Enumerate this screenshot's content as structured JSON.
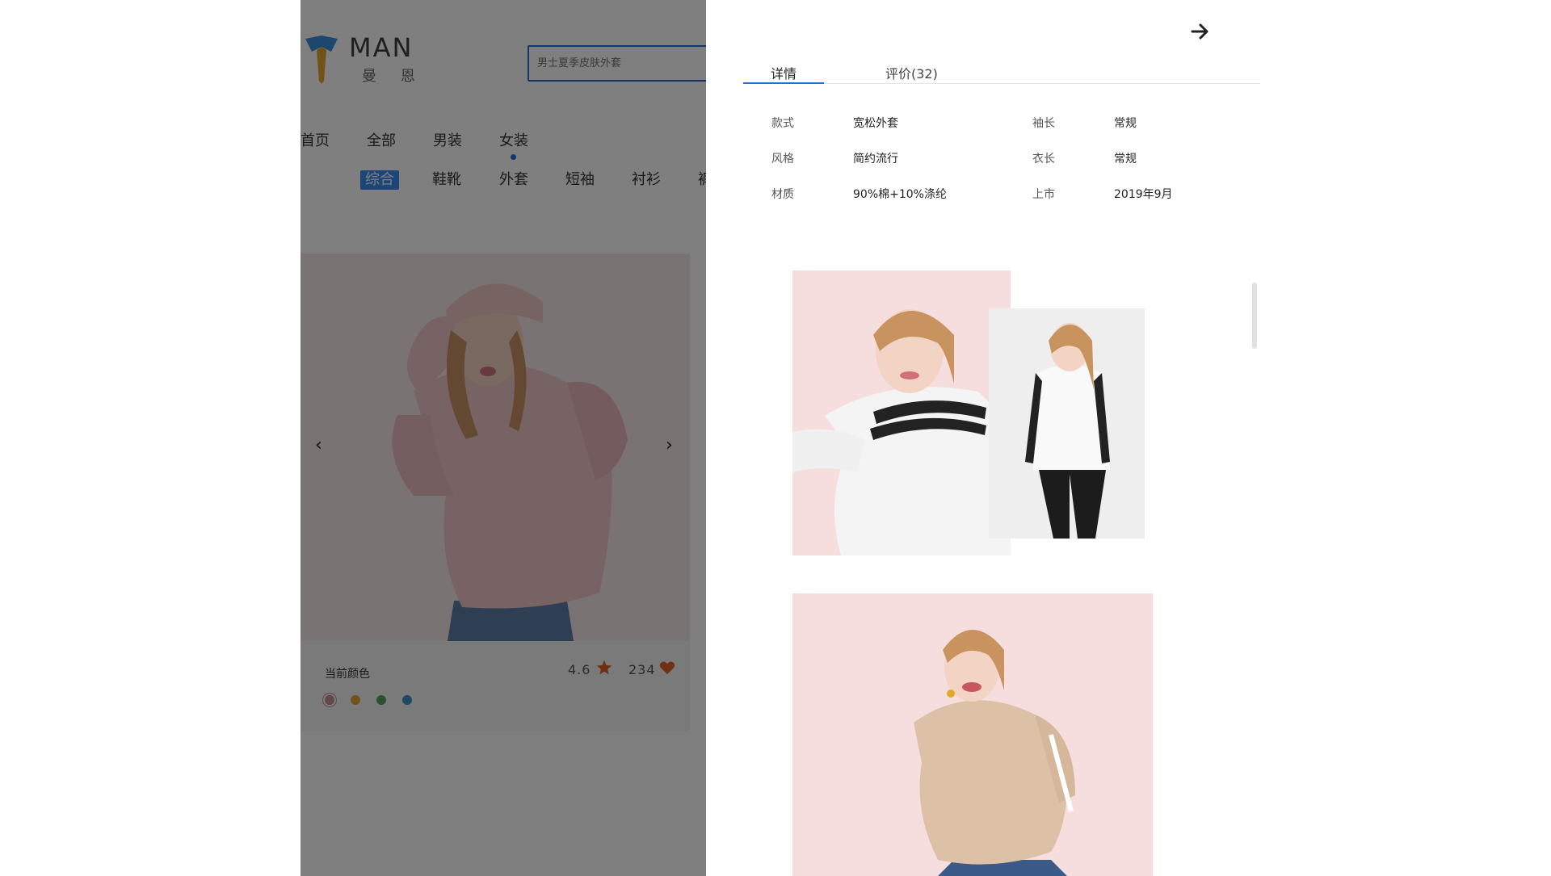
{
  "brand": {
    "name": "MAN",
    "name_cn": "曼 恩"
  },
  "search": {
    "placeholder": "男士夏季皮肤外套"
  },
  "nav": {
    "items": [
      {
        "label": "首页"
      },
      {
        "label": "全部"
      },
      {
        "label": "男装"
      },
      {
        "label": "女装",
        "active": true
      }
    ]
  },
  "subnav": {
    "items": [
      {
        "label": "综合",
        "active": true
      },
      {
        "label": "鞋靴"
      },
      {
        "label": "外套"
      },
      {
        "label": "短袖"
      },
      {
        "label": "衬衫"
      },
      {
        "label": "裤"
      }
    ]
  },
  "product": {
    "image": "woman-pink-hoodie-photo",
    "prev_icon": "‹",
    "next_icon": "›",
    "color_label": "当前颜色",
    "rating": "4.6",
    "likes": "234",
    "colors": [
      "#c98f97",
      "#e0a43a",
      "#5aa060",
      "#3b93c9"
    ],
    "selected_color_index": 0
  },
  "drawer": {
    "close_icon": "arrow-right-icon",
    "tabs": [
      {
        "label": "详情",
        "active": true
      },
      {
        "label": "评价(32)"
      }
    ],
    "specs": [
      {
        "label": "款式",
        "value": "宽松外套"
      },
      {
        "label": "袖长",
        "value": "常规"
      },
      {
        "label": "风格",
        "value": "简约流行"
      },
      {
        "label": "衣长",
        "value": "常规"
      },
      {
        "label": "材质",
        "value": "90%棉+10%涤纶"
      },
      {
        "label": "上市",
        "value": "2019年9月"
      }
    ],
    "images": [
      "woman-white-striped-hoodie-photo",
      "woman-white-hoodie-black-pants-photo",
      "woman-beige-hoodie-photo"
    ]
  },
  "colors": {
    "accent": "#1e6fd9",
    "star": "#e0612b",
    "heart": "#e0612b",
    "overlay": "rgba(0,0,0,0.5)"
  }
}
